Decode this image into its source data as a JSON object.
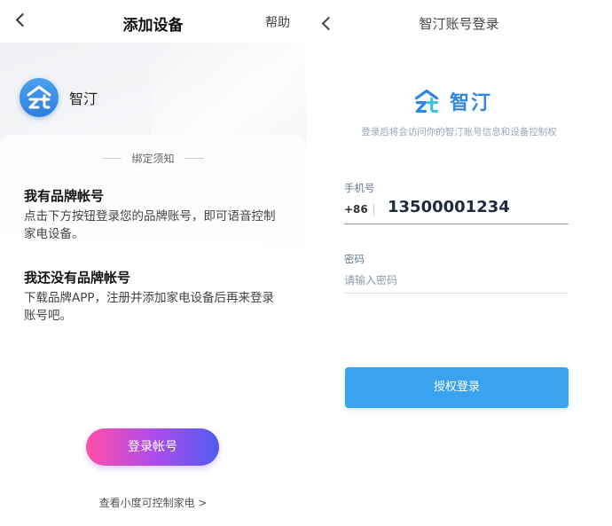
{
  "left": {
    "title": "添加设备",
    "help_label": "帮助",
    "brand_name": "智汀",
    "notice_label": "绑定须知",
    "has_account": {
      "title": "我有品牌帐号",
      "body": "点击下方按钮登录您的品牌账号，即可语音控制家电设备。"
    },
    "no_account": {
      "title": "我还没有品牌帐号",
      "body": "下载品牌APP，注册并添加家电设备后再来登录账号吧。"
    },
    "login_button": "登录帐号",
    "more_link": "查看小度可控制家电 >"
  },
  "right": {
    "title": "智汀账号登录",
    "brand_name": "智汀",
    "subtitle": "登录后将会访问你的智汀账号信息和设备控制权",
    "phone_label": "手机号",
    "country_code": "+86",
    "phone_value": "13500001234",
    "password_label": "密码",
    "password_placeholder": "请输入密码",
    "auth_button": "授权登录"
  },
  "colors": {
    "brand_blue": "#2f86e0",
    "auth_button": "#3aa3ef",
    "login_gradient_start": "#ff4fa8",
    "login_gradient_end": "#4f5bf0"
  },
  "icons": [
    "back-arrow-icon",
    "zhiting-logo-icon"
  ]
}
